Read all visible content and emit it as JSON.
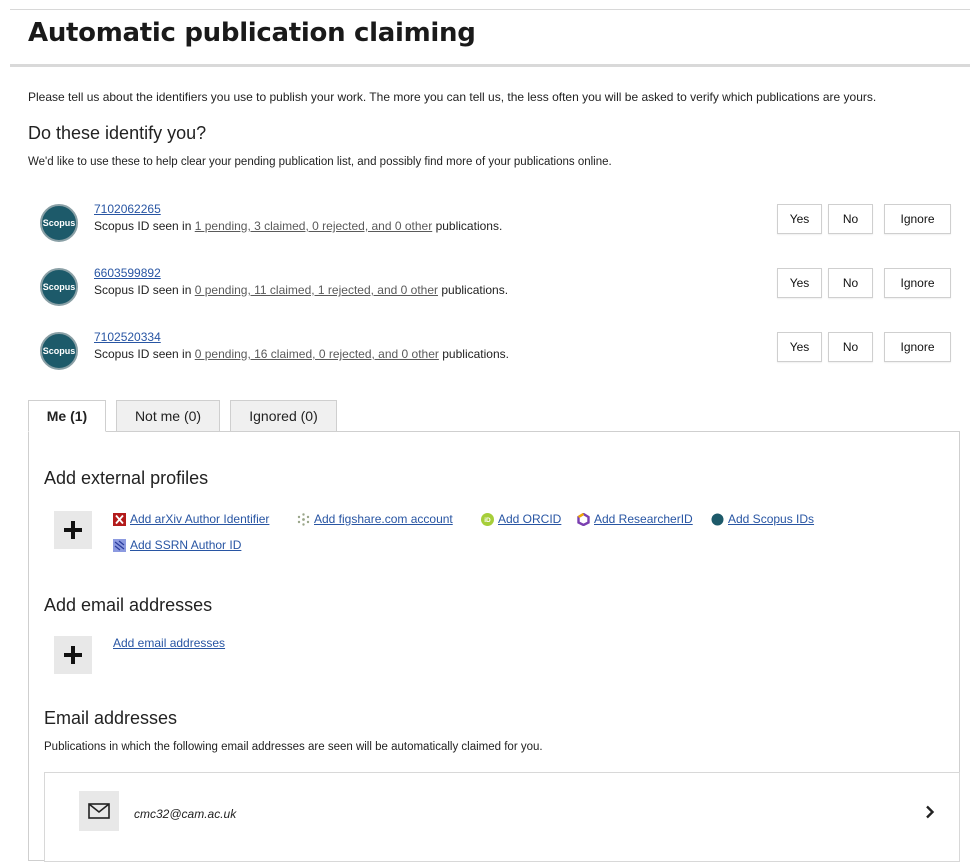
{
  "page": {
    "title": "Automatic publication claiming",
    "intro": "Please tell us about the identifiers you use to publish your work. The more you can tell us, the less often you will be asked to verify which publications are yours."
  },
  "identify": {
    "heading": "Do these identify you?",
    "subtext": "We'd like to use these to help clear your pending publication list, and possibly find more of your publications online.",
    "badge_label": "Scopus",
    "prefix": "Scopus ID seen in",
    "suffix": "publications.",
    "buttons": {
      "yes": "Yes",
      "no": "No",
      "ignore": "Ignore"
    },
    "rows": [
      {
        "id": "7102062265",
        "summary": "1 pending, 3 claimed, 0 rejected, and 0 other"
      },
      {
        "id": "6603599892",
        "summary": "0 pending, 11 claimed, 1 rejected, and 0 other"
      },
      {
        "id": "7102520334",
        "summary": "0 pending, 16 claimed, 0 rejected, and 0 other"
      }
    ]
  },
  "tabs": [
    {
      "label": "Me (1)",
      "active": true
    },
    {
      "label": "Not me (0)",
      "active": false
    },
    {
      "label": "Ignored (0)",
      "active": false
    }
  ],
  "external_profiles": {
    "heading": "Add external profiles",
    "links": [
      {
        "label": "Add arXiv Author Identifier",
        "icon": "arxiv-icon"
      },
      {
        "label": "Add figshare.com account",
        "icon": "figshare-icon"
      },
      {
        "label": "Add ORCID",
        "icon": "orcid-icon"
      },
      {
        "label": "Add ResearcherID",
        "icon": "researcherid-icon"
      },
      {
        "label": "Add Scopus IDs",
        "icon": "scopus-icon"
      },
      {
        "label": "Add SSRN Author ID",
        "icon": "ssrn-icon"
      }
    ]
  },
  "add_email": {
    "heading": "Add email addresses",
    "link": "Add email addresses"
  },
  "email_addresses": {
    "heading": "Email addresses",
    "note": "Publications in which the following email addresses are seen will be automatically claimed for you.",
    "items": [
      {
        "address": "cmc32@cam.ac.uk"
      }
    ]
  },
  "colors": {
    "link": "#2855a3",
    "scopus_badge": "#1d5a6a",
    "orcid": "#a6ce39",
    "arxiv": "#b31b1b"
  }
}
